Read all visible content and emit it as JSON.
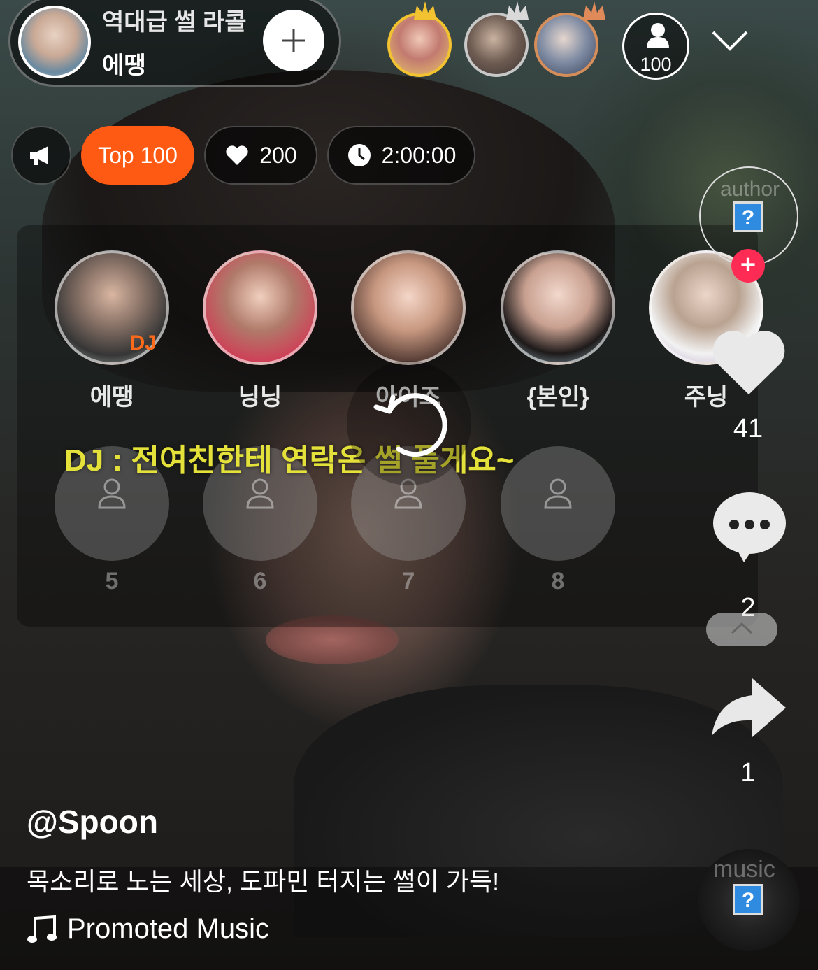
{
  "host": {
    "room_title": "역대급 썰 라콜",
    "name": "에땡",
    "follow_icon": "plus-icon"
  },
  "listener_count": "100",
  "chips": {
    "top_label": "Top 100",
    "likes": "200",
    "timer": "2:00:00"
  },
  "seats": [
    {
      "name": "에땡",
      "tag": "DJ"
    },
    {
      "name": "닝닝"
    },
    {
      "name": "아이즈"
    },
    {
      "name": "{본인}"
    },
    {
      "name": "주닝"
    }
  ],
  "empty_seats": [
    "5",
    "6",
    "7",
    "8"
  ],
  "caption": "DJ : 전여친한테 연락온 썰 풀게요~",
  "sidebar": {
    "author_alt": "author",
    "author_placeholder": "?",
    "like_count": "41",
    "comment_count": "2",
    "share_count": "1",
    "music_alt": "music",
    "music_placeholder": "?"
  },
  "post": {
    "username": "@Spoon",
    "description": "목소리로 노는 세상, 도파민 터지는 썰이 가득!",
    "music": "Promoted Music"
  },
  "colors": {
    "accent_orange": "#ff5a14",
    "caption_yellow": "#e3e13a",
    "follow_red": "#fe2c55",
    "dj_orange": "#ff6a1a"
  }
}
